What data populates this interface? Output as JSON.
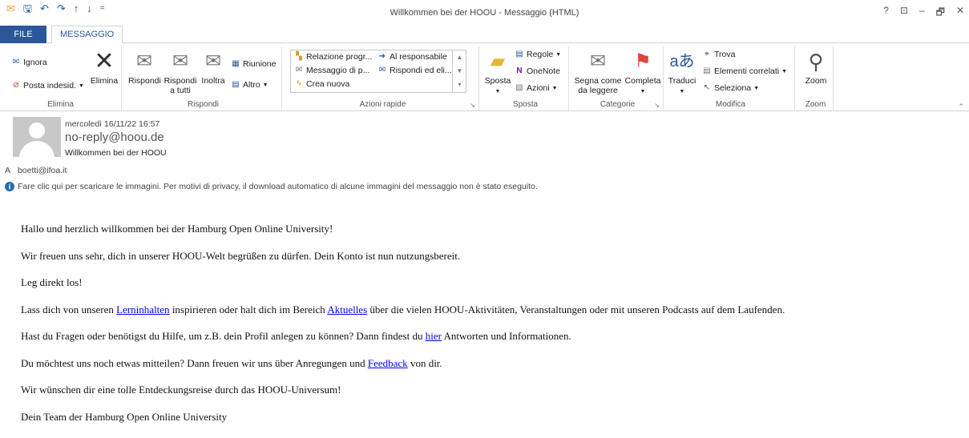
{
  "window": {
    "title": "Willkommen bei der HOOU - Messaggio (HTML)",
    "controls": [
      "?",
      "⊡",
      "–",
      "🗗",
      "✕"
    ]
  },
  "tabs": {
    "file": "FILE",
    "message": "MESSAGGIO"
  },
  "ribbon": {
    "elimina": {
      "ignora": "Ignora",
      "posta_indesid": "Posta indesid.",
      "elimina": "Elimina",
      "label": "Elimina"
    },
    "rispondi": {
      "rispondi": "Rispondi",
      "rispondi_tutti_1": "Rispondi",
      "rispondi_tutti_2": "a tutti",
      "inoltra": "Inoltra",
      "riunione": "Riunione",
      "altro": "Altro",
      "label": "Rispondi"
    },
    "azioni_rapide": {
      "items": [
        "Relazione progr...",
        "Al responsabile",
        "Messaggio di p...",
        "Rispondi ed eli...",
        "Crea nuova"
      ],
      "label": "Azioni rapide"
    },
    "sposta": {
      "sposta": "Sposta",
      "regole": "Regole",
      "onenote": "OneNote",
      "azioni": "Azioni",
      "label": "Sposta"
    },
    "categorie": {
      "segna_1": "Segna come",
      "segna_2": "da leggere",
      "completa": "Completa",
      "label": "Categorie"
    },
    "modifica": {
      "traduci": "Traduci",
      "trova": "Trova",
      "elementi": "Elementi correlati",
      "seleziona": "Seleziona",
      "label": "Modifica"
    },
    "zoom": {
      "zoom": "Zoom",
      "label": "Zoom"
    }
  },
  "message": {
    "date": "mercoledì 16/11/22 16:57",
    "from": "no-reply@hoou.de",
    "subject": "Willkommen bei der HOOU",
    "to_label": "A",
    "to": "boetti@ifoa.it",
    "info": "Fare clic qui per scaricare le immagini. Per motivi di privacy, il download automatico di alcune immagini del messaggio non è stato eseguito."
  },
  "body": {
    "p1": "Hallo und herzlich willkommen bei der Hamburg Open Online University!",
    "p2": "Wir freuen uns sehr, dich in unserer HOOU-Welt begrüßen zu dürfen. Dein Konto ist nun nutzungsbereit.",
    "p3": "Leg direkt los!",
    "p4a": "Lass dich von unseren ",
    "p4_link1": "Lerninhalten",
    "p4b": " inspirieren oder halt dich im Bereich ",
    "p4_link2": "Aktuelles",
    "p4c": " über die vielen HOOU-Aktivitäten, Veranstaltungen oder mit unseren Podcasts auf dem Laufenden.",
    "p5a": "Hast du Fragen oder benötigst du Hilfe, um z.B. dein Profil anlegen zu können? Dann findest du ",
    "p5_link": "hier",
    "p5b": " Antworten und Informationen.",
    "p6a": "Du möchtest uns noch etwas mitteilen? Dann freuen wir uns über Anregungen und ",
    "p6_link": "Feedback",
    "p6b": " von dir.",
    "p7": "Wir wünschen dir eine tolle Entdeckungsreise durch das HOOU-Universum!",
    "p8": "Dein Team der Hamburg Open Online University"
  }
}
